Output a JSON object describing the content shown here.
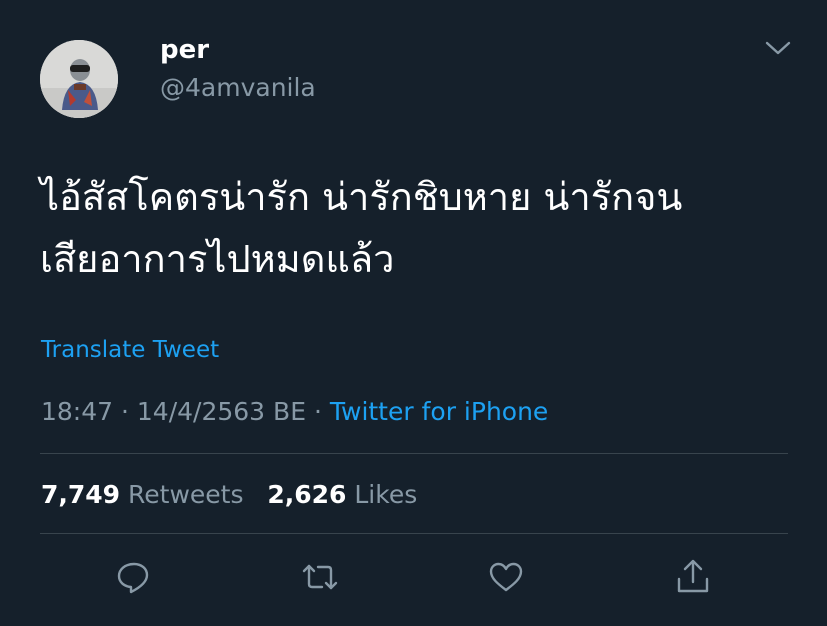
{
  "user": {
    "display_name": "per",
    "handle": "@4amvanila"
  },
  "tweet": {
    "text_line1": "ไอ้สัสโคตรน่ารัก น่ารักชิบหาย น่ารักจน",
    "text_line2": "เสียอาการไปหมดแล้ว",
    "translate_label": "Translate Tweet",
    "time": "18:47",
    "separator": "·",
    "date": "14/4/2563 BE",
    "source": "Twitter for iPhone"
  },
  "stats": {
    "retweets_count": "7,749",
    "retweets_label": "Retweets",
    "likes_count": "2,626",
    "likes_label": "Likes"
  },
  "icons": {
    "menu": "chevron-down-icon",
    "reply": "reply-icon",
    "retweet": "retweet-icon",
    "like": "heart-icon",
    "share": "share-icon"
  },
  "colors": {
    "background": "#15202b",
    "primary_text": "#ffffff",
    "secondary_text": "#8899a6",
    "accent": "#1da1f2",
    "divider": "#38444d"
  }
}
